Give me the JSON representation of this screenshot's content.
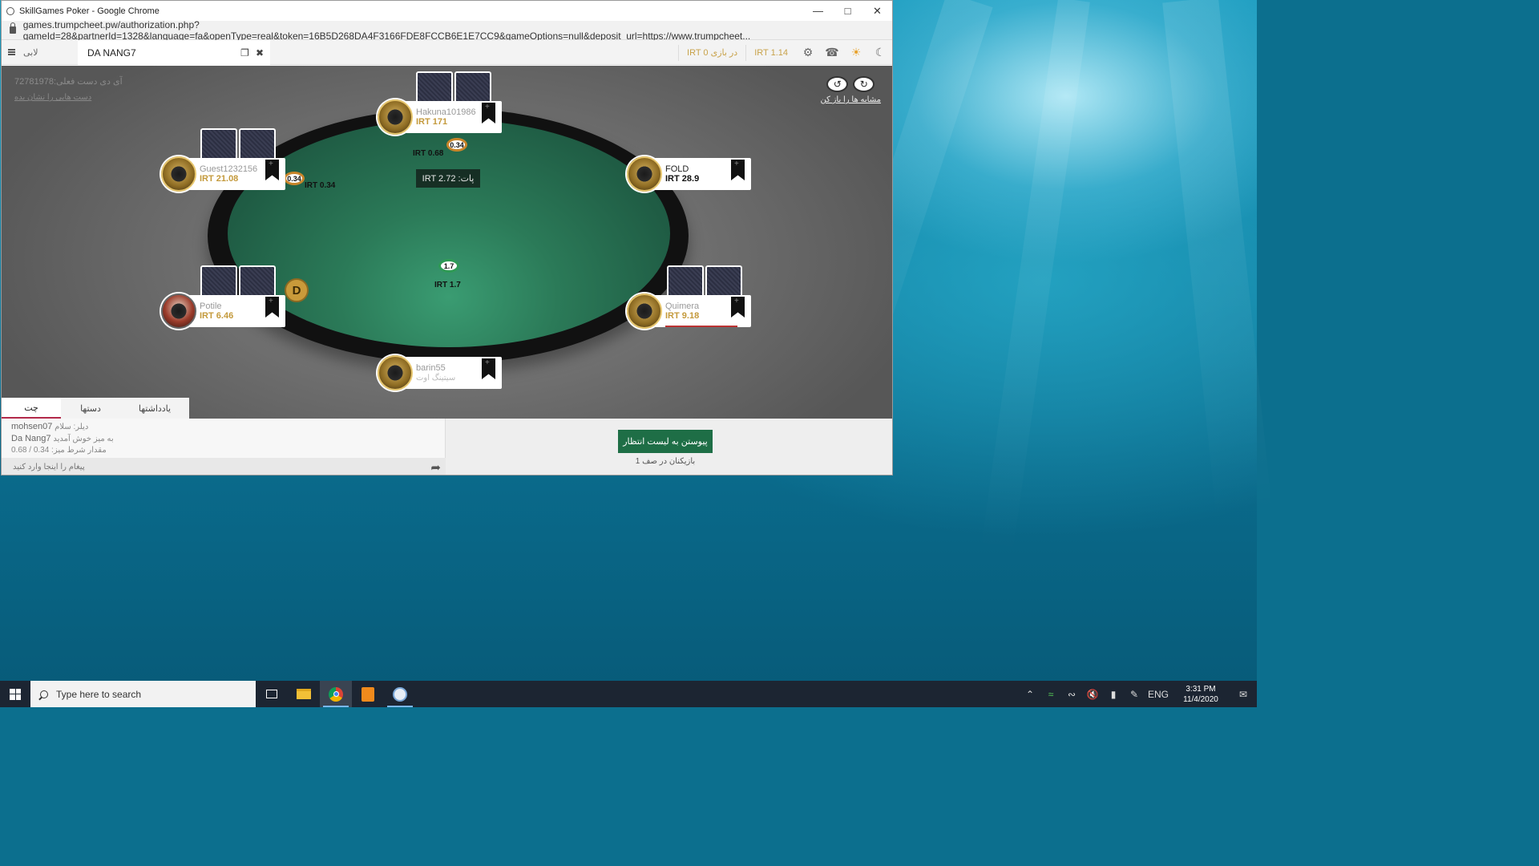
{
  "browser": {
    "window_title": "SkillGames Poker - Google Chrome",
    "url": "games.trumpcheet.pw/authorization.php?gameId=28&partnerId=1328&language=fa&openType=real&token=16B5D268DA4F3166FDE8FCCB6E1E7CC9&gameOptions=null&deposit_url=https://www.trumpcheet..."
  },
  "appbar": {
    "lobby_label": "لابی",
    "table_tab": "DA NANG7",
    "in_play_balance": "IRT 0 در بازی",
    "balance": "IRT 1.14"
  },
  "game": {
    "hand_id": "72781978:آی دی دست فعلی",
    "show_hands": "دست هایی را نشان بده",
    "similar_open_label": "مشابه ها را باز کن",
    "pot": "IRT 2.72 :پات",
    "center_chip": "1.7",
    "center_amount": "IRT 1.7",
    "dealer_label": "D",
    "bets": [
      {
        "chip": "0.34",
        "amount": "IRT 0.68"
      },
      {
        "chip": "0.34",
        "amount": "IRT 0.34"
      }
    ]
  },
  "seats": [
    {
      "name": "Hakuna101986",
      "chips": "IRT 171"
    },
    {
      "name": "Guest1232156",
      "chips": "IRT 21.08"
    },
    {
      "name": "FOLD",
      "chips": "IRT 28.9"
    },
    {
      "name": "Potile",
      "chips": "IRT 6.46"
    },
    {
      "name": "Quimera",
      "chips": "IRT 9.18"
    },
    {
      "name": "barin55",
      "status": "سیتینگ اوت"
    }
  ],
  "bottom": {
    "tabs": [
      "چت",
      "دستها",
      "یادداشتها"
    ],
    "chat": [
      {
        "user": "mohsen07",
        "text": "دیلر: سلام"
      },
      {
        "user": "Da Nang7",
        "text": "به میز خوش آمدید"
      },
      {
        "user": "",
        "text": "مقدار شرط میز: 0.34 / 0.68"
      }
    ],
    "chat_placeholder": "پیغام را اینجا وارد کنید",
    "join_waitlist": "پیوستن به لیست انتظار",
    "waitlist_count": "بازیکنان در صف 1"
  },
  "taskbar": {
    "search_placeholder": "Type here to search",
    "lang": "ENG",
    "time": "3:31 PM",
    "date": "11/4/2020"
  }
}
